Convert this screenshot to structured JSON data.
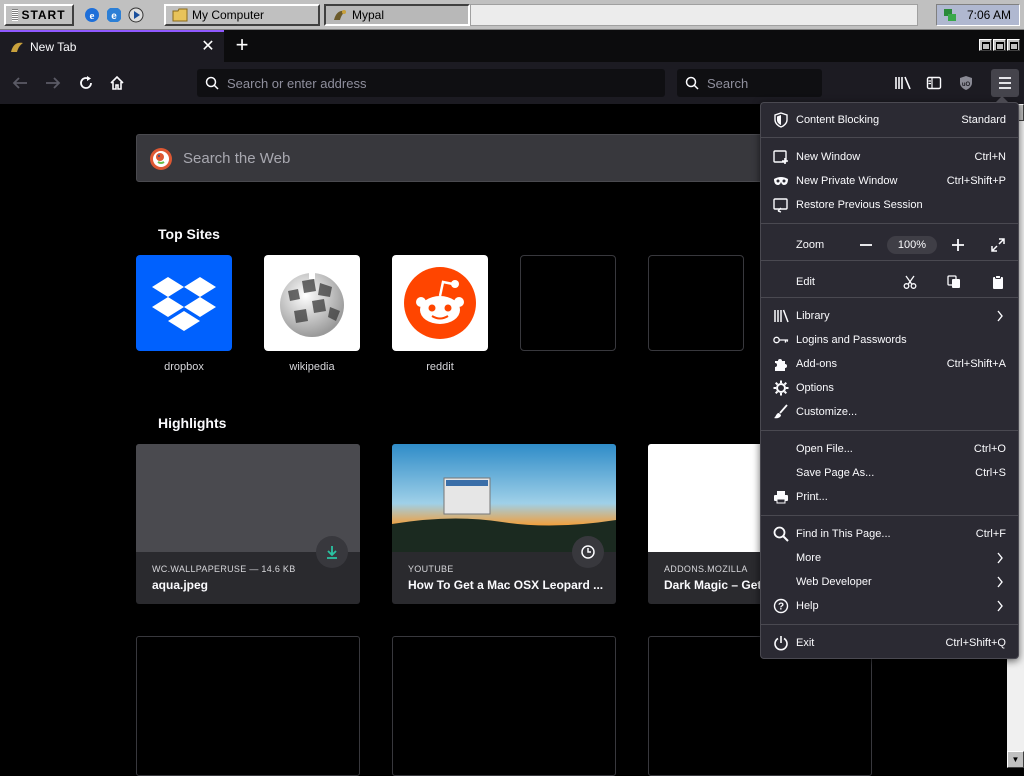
{
  "taskbar": {
    "start_label": "START",
    "tasks": [
      {
        "label": "My Computer",
        "icon": "folder-icon"
      },
      {
        "label": "Mypal",
        "icon": "mypal-icon"
      }
    ],
    "clock": "7:06 AM"
  },
  "browser": {
    "tab_title": "New Tab",
    "address_placeholder": "Search or enter address",
    "search_placeholder": "Search"
  },
  "newtab": {
    "web_search_placeholder": "Search the Web",
    "top_sites_title": "Top Sites",
    "top_sites": [
      {
        "label": "dropbox",
        "icon": "dropbox-icon",
        "color": "#0061fe"
      },
      {
        "label": "wikipedia",
        "icon": "wikipedia-icon",
        "color": "#ffffff"
      },
      {
        "label": "reddit",
        "icon": "reddit-icon",
        "color": "#ff4500"
      }
    ],
    "highlights_title": "Highlights",
    "highlights": [
      {
        "source": "WC.WALLPAPERUSE — 14.6 KB",
        "title": "aqua.jpeg",
        "badge": "download-icon"
      },
      {
        "source": "YOUTUBE",
        "title": "How To Get a Mac OSX Leopard ...",
        "badge": "clock-icon"
      },
      {
        "source": "ADDONS.MOZILLA",
        "title": "Dark Magic – Get"
      }
    ]
  },
  "app_menu": {
    "content_blocking": {
      "label": "Content Blocking",
      "value": "Standard"
    },
    "new_window": {
      "label": "New Window",
      "shortcut": "Ctrl+N"
    },
    "new_private_window": {
      "label": "New Private Window",
      "shortcut": "Ctrl+Shift+P"
    },
    "restore_session": {
      "label": "Restore Previous Session"
    },
    "zoom": {
      "label": "Zoom",
      "value": "100%"
    },
    "edit": {
      "label": "Edit"
    },
    "library": {
      "label": "Library"
    },
    "logins": {
      "label": "Logins and Passwords"
    },
    "addons": {
      "label": "Add-ons",
      "shortcut": "Ctrl+Shift+A"
    },
    "options": {
      "label": "Options"
    },
    "customize": {
      "label": "Customize..."
    },
    "open_file": {
      "label": "Open File...",
      "shortcut": "Ctrl+O"
    },
    "save_page": {
      "label": "Save Page As...",
      "shortcut": "Ctrl+S"
    },
    "print": {
      "label": "Print..."
    },
    "find": {
      "label": "Find in This Page...",
      "shortcut": "Ctrl+F"
    },
    "more": {
      "label": "More"
    },
    "web_developer": {
      "label": "Web Developer"
    },
    "help": {
      "label": "Help"
    },
    "exit": {
      "label": "Exit",
      "shortcut": "Ctrl+Shift+Q"
    }
  },
  "colors": {
    "accent": "#9059ff",
    "menu_bg": "#2b2a33",
    "page_bg": "#000000",
    "download_green": "#2ac3a2"
  }
}
